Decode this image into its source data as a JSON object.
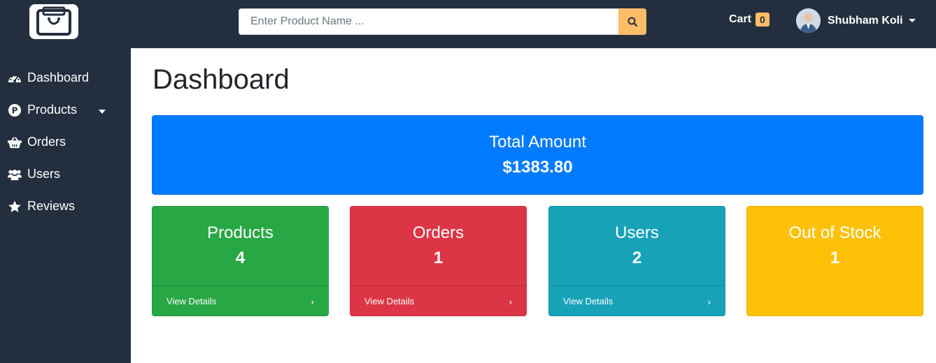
{
  "header": {
    "search": {
      "placeholder": "Enter Product Name ...",
      "value": ""
    },
    "cart": {
      "label": "Cart",
      "count": "0"
    },
    "user": {
      "name": "Shubham Koli"
    }
  },
  "sidebar": {
    "items": [
      {
        "label": "Dashboard",
        "icon": "tachometer-icon"
      },
      {
        "label": "Products",
        "icon": "product-p-icon"
      },
      {
        "label": "Orders",
        "icon": "shopping-basket-icon"
      },
      {
        "label": "Users",
        "icon": "users-icon"
      },
      {
        "label": "Reviews",
        "icon": "star-icon"
      }
    ]
  },
  "main": {
    "title": "Dashboard",
    "total": {
      "label": "Total Amount",
      "value": "$1383.80"
    },
    "cards": [
      {
        "label": "Products",
        "value": "4",
        "link": "View Details",
        "color": "#28a745"
      },
      {
        "label": "Orders",
        "value": "1",
        "link": "View Details",
        "color": "#dc3545"
      },
      {
        "label": "Users",
        "value": "2",
        "link": "View Details",
        "color": "#17a2b8"
      },
      {
        "label": "Out of Stock",
        "value": "1",
        "color": "#ffc107"
      }
    ]
  },
  "colors": {
    "nav": "#232f3e",
    "accent": "#febd69",
    "primary": "#007bff"
  }
}
